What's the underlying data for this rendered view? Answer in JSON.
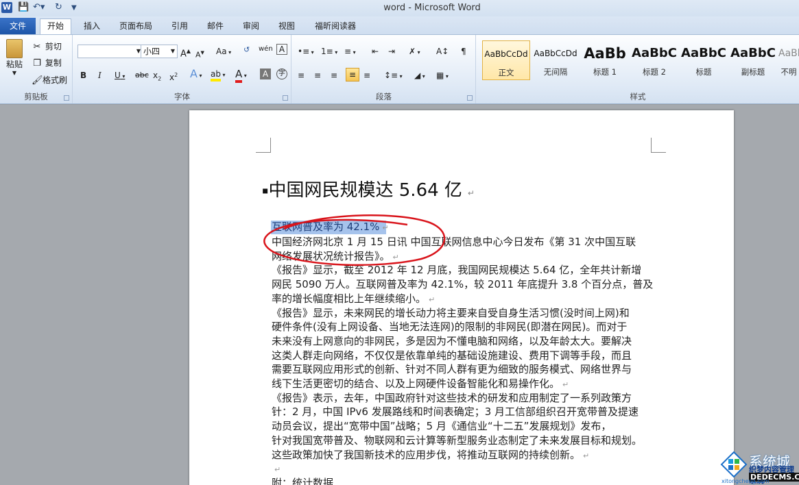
{
  "window": {
    "title": "word - Microsoft Word",
    "logo": "W"
  },
  "tabs": {
    "file": "文件",
    "home": "开始",
    "insert": "插入",
    "layout": "页面布局",
    "references": "引用",
    "mailings": "邮件",
    "review": "审阅",
    "view": "视图",
    "reader": "福昕阅读器"
  },
  "clipboard": {
    "paste": "粘贴",
    "cut": "剪切",
    "copy": "复制",
    "format_painter": "格式刷",
    "label": "剪贴板"
  },
  "font": {
    "name": "",
    "size": "小四",
    "label": "字体",
    "aa": "Aa"
  },
  "paragraph": {
    "label": "段落"
  },
  "styles": {
    "label": "样式",
    "items": [
      {
        "sample": "AaBbCcDd",
        "name": "正文"
      },
      {
        "sample": "AaBbCcDd",
        "name": "无间隔"
      },
      {
        "sample": "AaBb",
        "name": "标题 1"
      },
      {
        "sample": "AaBbC",
        "name": "标题 2"
      },
      {
        "sample": "AaBbC",
        "name": "标题"
      },
      {
        "sample": "AaBbC",
        "name": "副标题"
      },
      {
        "sample": "AaBbC",
        "name": "不明"
      }
    ]
  },
  "document": {
    "heading": "中国网民规模达 5.64 亿",
    "selected": "互联网普及率为 42.1%",
    "lines": [
      "中国经济网北京 1 月 15 日讯 中国互联网信息中心今日发布《第 31 次中国互联",
      "网络发展状况统计报告》。",
      "《报告》显示，截至 2012 年 12 月底，我国网民规模达 5.64 亿，全年共计新增",
      "网民 5090 万人。互联网普及率为 42.1%，较 2011 年底提升 3.8 个百分点，普及",
      "率的增长幅度相比上年继续缩小。",
      "《报告》显示，未来网民的增长动力将主要来自受自身生活习惯(没时间上网)和",
      "硬件条件(没有上网设备、当地无法连网)的限制的非网民(即潜在网民)。而对于",
      "未来没有上网意向的非网民，多是因为不懂电脑和网络，以及年龄太大。要解决",
      "这类人群走向网络，不仅仅是依靠单纯的基础设施建设、费用下调等手段，而且",
      "需要互联网应用形式的创新、针对不同人群有更为细致的服务模式、网络世界与",
      "线下生活更密切的结合、以及上网硬件设备智能化和易操作化。",
      "《报告》表示，去年，中国政府针对这些技术的研发和应用制定了一系列政策方",
      "针：2 月，中国 IPv6 发展路线和时间表确定；3 月工信部组织召开宽带普及提速",
      "动员会议，提出“宽带中国”战略；5 月《通信业“十二五”发展规划》发布，",
      "针对我国宽带普及、物联网和云计算等新型服务业态制定了未来发展目标和规划。",
      "这些政策加快了我国新技术的应用步伐，将推动互联网的持续创新。",
      "",
      "附：统计数据"
    ]
  },
  "watermark": {
    "brand": "系统城",
    "site": "xitongcheng.com",
    "cms": "织梦内容管理系统",
    "url": "DEDECMS.COM"
  },
  "colors": {
    "accent": "#1d55a8",
    "selection": "#a6c3ec",
    "circle": "#d9141b"
  }
}
